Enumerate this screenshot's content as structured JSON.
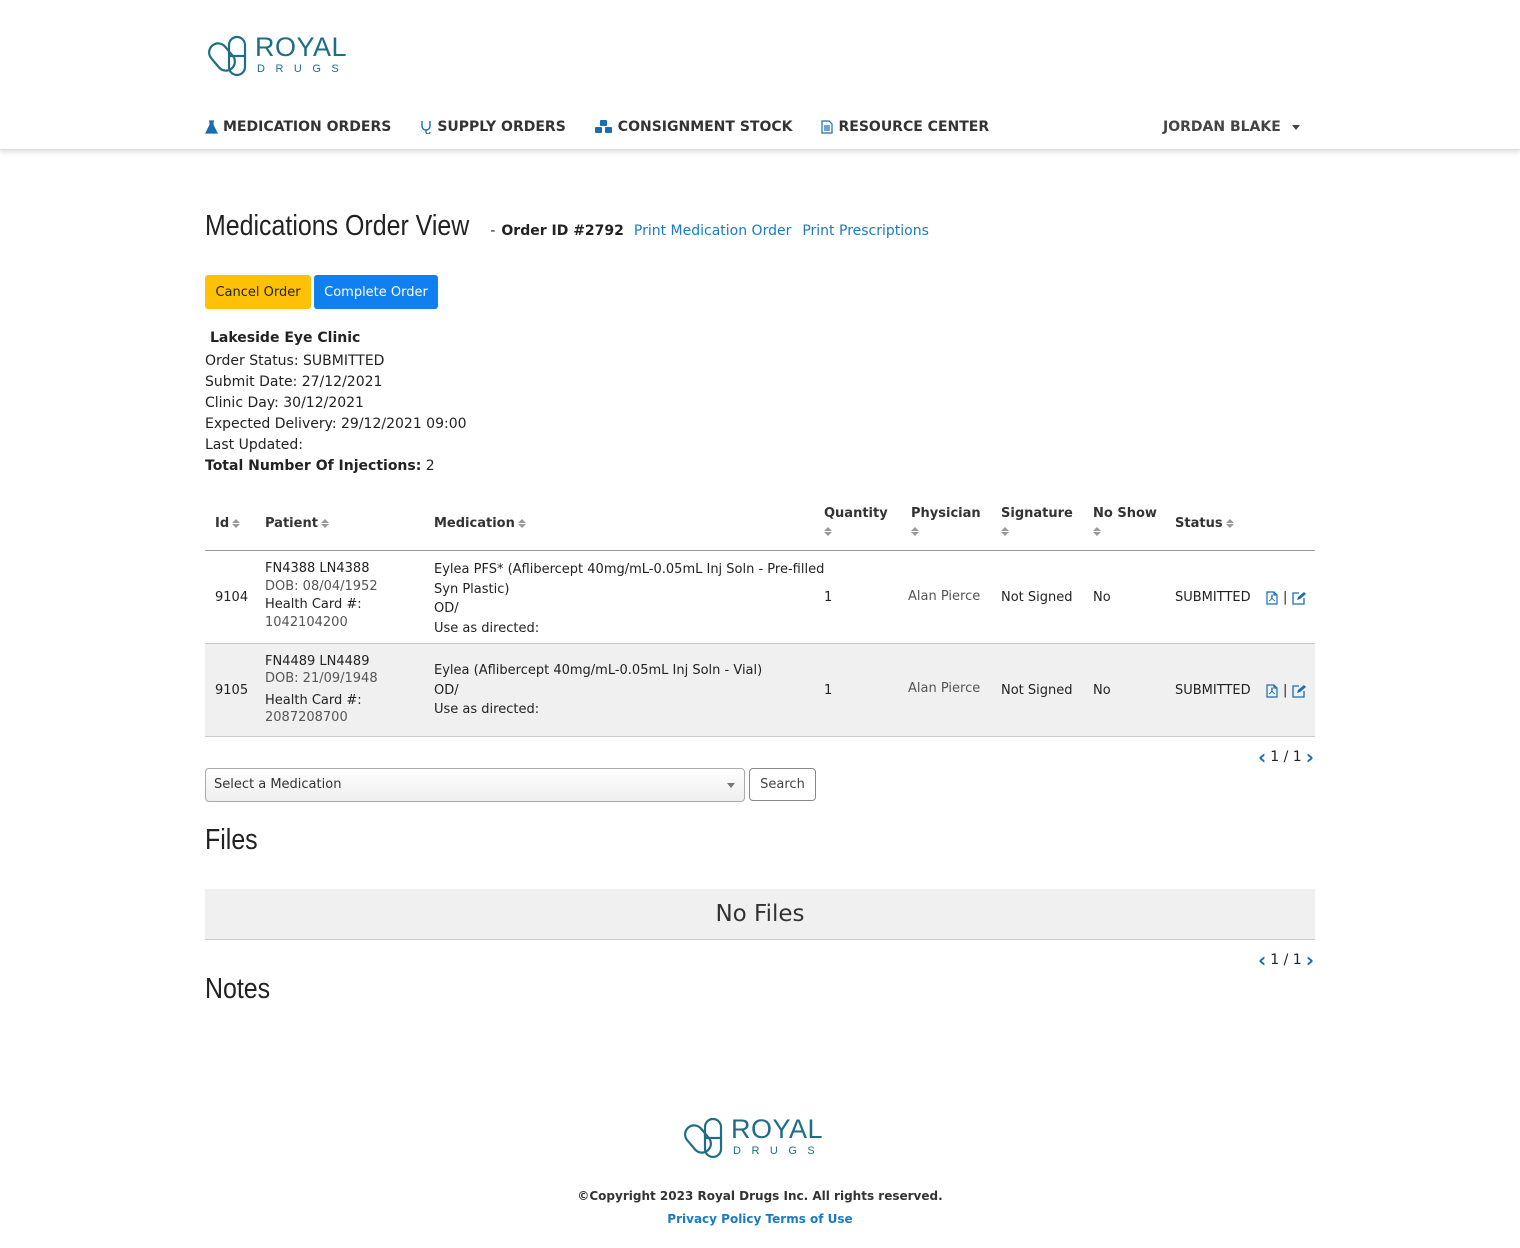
{
  "brand": {
    "name": "ROYAL",
    "sub": "DRUGS",
    "color": "#1e6e86"
  },
  "nav": {
    "items": [
      {
        "label": "MEDICATION ORDERS",
        "icon": "flask-icon"
      },
      {
        "label": "SUPPLY ORDERS",
        "icon": "stethoscope-icon"
      },
      {
        "label": "CONSIGNMENT STOCK",
        "icon": "cubes-icon"
      },
      {
        "label": "RESOURCE CENTER",
        "icon": "document-icon"
      }
    ],
    "user": "JORDAN BLAKE"
  },
  "page": {
    "title": "Medications Order View",
    "separator": "-",
    "order_id": "Order ID #2792",
    "print_order": "Print Medication Order",
    "print_prescriptions": "Print Prescriptions",
    "cancel_label": "Cancel Order",
    "complete_label": "Complete Order"
  },
  "order": {
    "clinic": "Lakeside Eye Clinic",
    "status": "Order Status: SUBMITTED",
    "submit_date": "Submit Date: 27/12/2021",
    "clinic_day": "Clinic Day: 30/12/2021",
    "expected_delivery": "Expected Delivery: 29/12/2021 09:00",
    "last_updated": "Last Updated:",
    "injections_label": "Total Number Of Injections:",
    "injections_value": "2"
  },
  "table": {
    "headers": {
      "id": "Id",
      "patient": "Patient",
      "medication": "Medication",
      "quantity": "Quantity",
      "physician": "Physician",
      "signature": "Signature",
      "no_show": "No Show",
      "status": "Status"
    },
    "rows": [
      {
        "id": "9104",
        "patient_name": "FN4388 LN4388",
        "dob": "DOB: 08/04/1952",
        "health_card_label": "Health Card #:",
        "health_card": "1042104200",
        "med_line1": "Eylea PFS* (Aflibercept 40mg/mL-0.05mL Inj Soln - Pre-filled",
        "med_line2": "Syn Plastic)",
        "med_line3": "OD/",
        "med_line4": "Use as directed:",
        "quantity": "1",
        "physician": "Alan Pierce",
        "signature": "Not Signed",
        "no_show": "No",
        "status": "SUBMITTED"
      },
      {
        "id": "9105",
        "patient_name": "FN4489 LN4489",
        "dob": "DOB: 21/09/1948",
        "health_card_label": "Health Card #:",
        "health_card": "2087208700",
        "med_line1": "Eylea (Aflibercept 40mg/mL-0.05mL Inj Soln - Vial)",
        "med_line2": "OD/",
        "med_line3": "Use as directed:",
        "quantity": "1",
        "physician": "Alan Pierce",
        "signature": "Not Signed",
        "no_show": "No",
        "status": "SUBMITTED"
      }
    ],
    "pager": "1 / 1"
  },
  "medication_search": {
    "placeholder": "Select a Medication",
    "button": "Search"
  },
  "files": {
    "title": "Files",
    "empty": "No Files",
    "pager": "1 / 1"
  },
  "notes": {
    "title": "Notes"
  },
  "footer": {
    "copyright": "©Copyright 2023 Royal Drugs Inc. All rights reserved.",
    "privacy": "Privacy Policy",
    "terms": "Terms of Use"
  }
}
